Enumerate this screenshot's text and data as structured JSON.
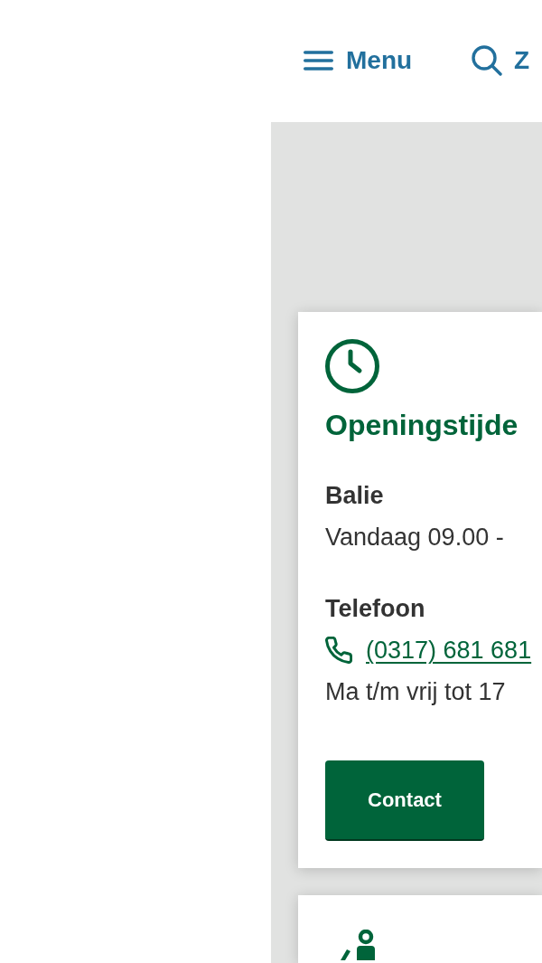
{
  "header": {
    "menu_button": {
      "label": "Menu"
    },
    "search_button": {
      "label": "Z"
    }
  },
  "cards": [
    {
      "kind": "hours",
      "title": "Openingstijde",
      "sections": [
        {
          "heading": "Balie",
          "lines": [
            {
              "kind": "text",
              "text": "Vandaag 09.00 -"
            }
          ]
        },
        {
          "heading": "Telefoon",
          "lines": [
            {
              "kind": "phone",
              "text": "(0317) 681 681"
            },
            {
              "kind": "text",
              "text": "Ma t/m vrij tot 17"
            }
          ]
        }
      ],
      "button": {
        "label": "Contact"
      }
    },
    {
      "kind": "service"
    }
  ]
}
